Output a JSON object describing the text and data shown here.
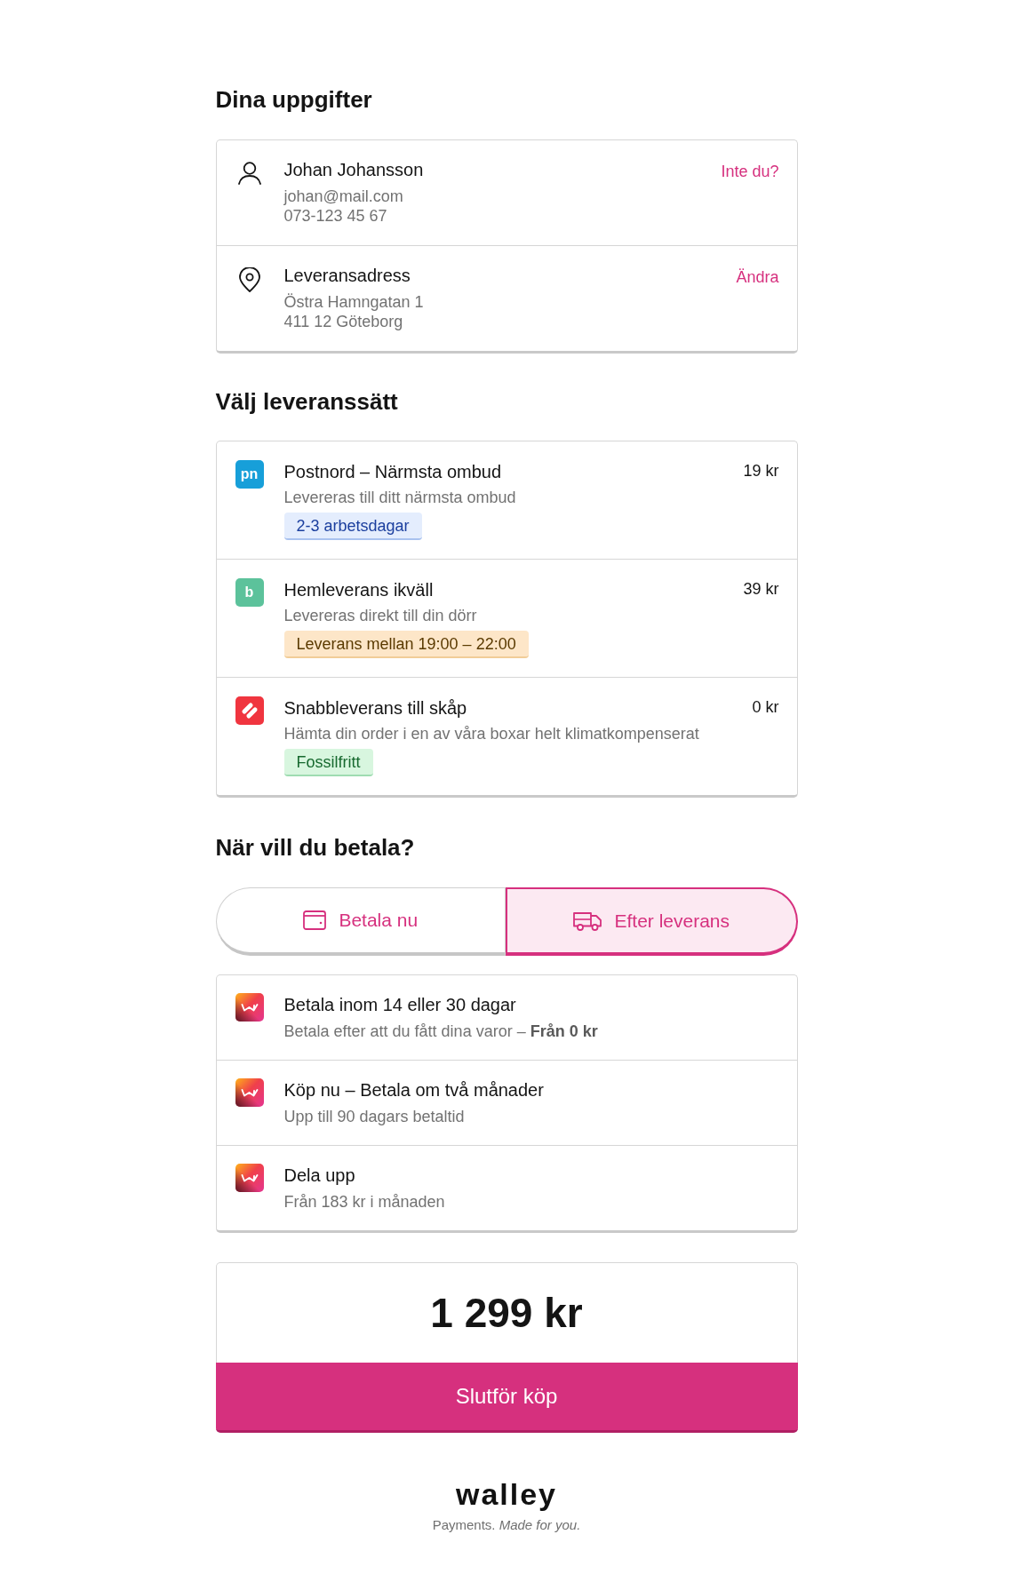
{
  "details": {
    "title": "Dina uppgifter",
    "rows": [
      {
        "title": "Johan Johansson",
        "lines": [
          "johan@mail.com",
          "073-123 45 67"
        ],
        "action": "Inte du?"
      },
      {
        "title": "Leveransadress",
        "lines": [
          "Östra Hamngatan 1",
          "411 12 Göteborg"
        ],
        "action": "Ändra"
      }
    ]
  },
  "delivery": {
    "title": "Välj leveranssätt",
    "options": [
      {
        "logo": {
          "kind": "letters",
          "text": "pn",
          "color": "#179fd9"
        },
        "name": "Postnord – Närmsta ombud",
        "price": "19 kr",
        "description": "Levereras till ditt närmsta ombud",
        "badge": {
          "text": "2-3 arbetsdagar",
          "kind": "info"
        }
      },
      {
        "logo": {
          "kind": "letters",
          "text": "b",
          "color": "#5cc29b"
        },
        "name": "Hemleverans ikväll",
        "price": "39 kr",
        "description": "Levereras direkt till din dörr",
        "badge": {
          "text": "Leverans mellan 19:00 – 22:00",
          "kind": "warning"
        }
      },
      {
        "logo": {
          "kind": "stripes",
          "color": "#f0353f"
        },
        "name": "Snabbleverans till skåp",
        "price": "0 kr",
        "description": "Hämta din order i en av våra boxar helt klimatkompenserat",
        "badge": {
          "text": "Fossilfritt",
          "kind": "success"
        }
      }
    ]
  },
  "payment": {
    "title": "När vill du betala?",
    "tabs": [
      {
        "label": "Betala nu",
        "selected": false
      },
      {
        "label": "Efter leverans",
        "selected": true
      }
    ],
    "options": [
      {
        "name": "Betala inom 14 eller 30 dagar",
        "description": "Betala efter att du fått dina varor – **Från 0 kr**"
      },
      {
        "name": "Köp nu – Betala om två månader",
        "description": "Upp till 90 dagars betaltid"
      },
      {
        "name": "Dela upp",
        "description": "Från 183 kr i månaden"
      }
    ]
  },
  "total": {
    "amount": "1 299 kr",
    "button": "Slutför köp"
  },
  "footer": {
    "logo": "walley",
    "tagline": "Payments. *Made for you.*"
  }
}
